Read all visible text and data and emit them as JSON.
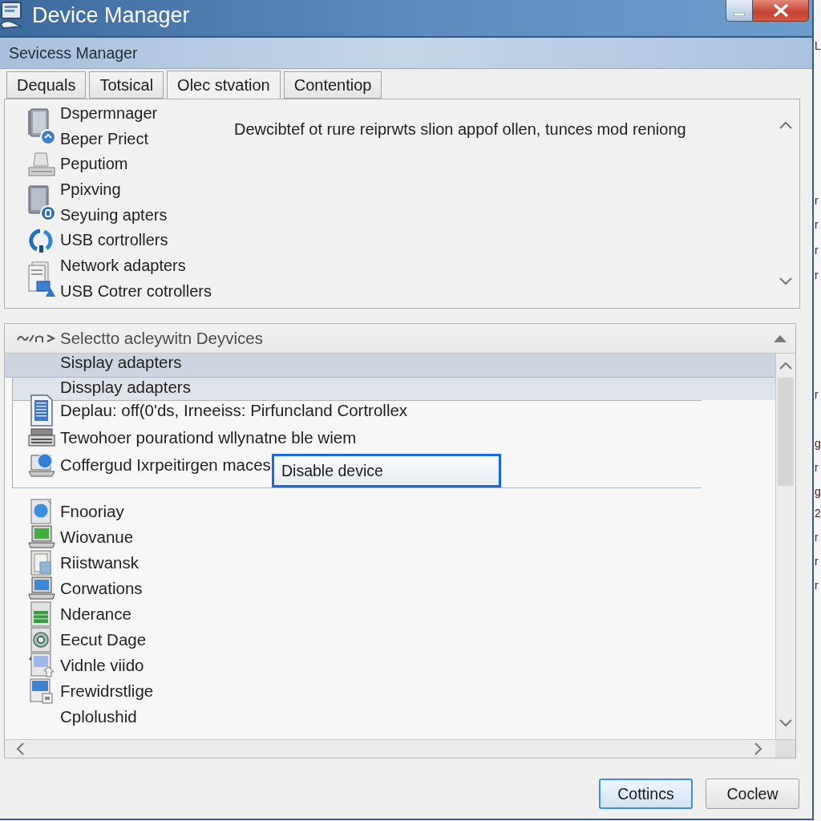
{
  "window": {
    "title": "Device Manager",
    "controls": [
      {
        "kind": "minimize"
      },
      {
        "kind": "close"
      }
    ]
  },
  "header": {
    "title": "Sevicess Manager"
  },
  "tabs": [
    {
      "label": "Dequals",
      "selected": false
    },
    {
      "label": "Totsical",
      "selected": false
    },
    {
      "label": "Olec stvation",
      "selected": true
    },
    {
      "label": "Contentiop",
      "selected": false
    }
  ],
  "top_panel": {
    "groups": [
      {
        "labels": [
          "Dspermnager",
          "Beper Priect"
        ]
      },
      {
        "labels": [
          "Peputiom"
        ]
      },
      {
        "labels": [
          "Ppixving",
          "Seyuing apters"
        ]
      },
      {
        "labels": [
          "USB cortrollers"
        ]
      },
      {
        "labels": [
          "Network adapters",
          "USB Cotrer cotrollers"
        ]
      }
    ],
    "description": "Dewcibtef ot rure reiprwts slion appof ollen, tunces mod reniong"
  },
  "device_list": {
    "title": "Selectto acleywitn Deyvices",
    "rows": [
      {
        "label": "Sisplay adapters",
        "selected": true
      },
      {
        "label": "Dissplay adapters",
        "selected": false,
        "expanded": true,
        "children": [
          {
            "label": "Deplau: off(0'ds, Irneeiss: Pirfuncland Cortrollex"
          },
          {
            "label": "Tewohoer pourationd wllynatne ble wiem"
          },
          {
            "label": "Coffergud Ixrpeitirgen maces"
          }
        ]
      },
      {
        "label": "Fnooriay",
        "selected": false
      },
      {
        "label": "Wiovanue",
        "selected": false
      },
      {
        "label": "Riistwansk",
        "selected": false
      },
      {
        "label": "Corwations",
        "selected": false
      },
      {
        "label": "Nderance",
        "selected": false
      },
      {
        "label": "Eecut Dage",
        "selected": false
      },
      {
        "label": "Vidnle viido",
        "selected": false
      },
      {
        "label": "Frewidrstlige",
        "selected": false
      },
      {
        "label": "Cplolushid",
        "selected": false
      }
    ]
  },
  "context_menu": {
    "items": [
      {
        "label": "Disable device",
        "selected": true
      }
    ]
  },
  "buttons": [
    {
      "label": "Cottincs",
      "default": true
    },
    {
      "label": "Coclew",
      "default": false
    }
  ],
  "background_window": {
    "fragments": [
      "L",
      "r",
      "r",
      "r",
      "r",
      "r",
      "g",
      "r",
      "g",
      "2",
      "r",
      "r",
      "r"
    ]
  }
}
